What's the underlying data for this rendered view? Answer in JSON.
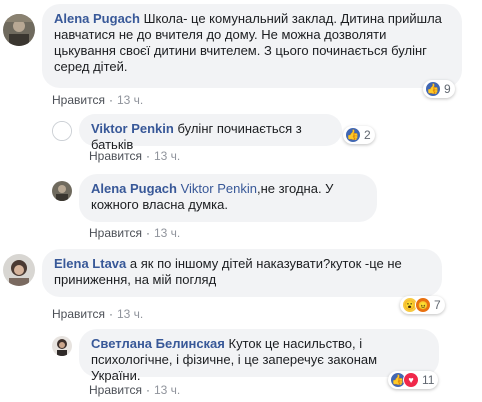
{
  "comments": [
    {
      "author": "Alena Pugach",
      "text": "Школа- це комунальний заклад. Дитина прийшла навчатися не до вчителя до дому. Не можна дозволяти цькування своєї дитини вчителем. З цього починається булінг серед дітей.",
      "like_label": "Нравится",
      "time": "13 ч.",
      "reaction_count": "9"
    },
    {
      "author": "Viktor Penkin",
      "text": "булінг починається з батьків",
      "like_label": "Нравится",
      "time": "13 ч.",
      "reaction_count": "2"
    },
    {
      "author": "Alena Pugach",
      "mention": "Viktor Penkin",
      "text": ",не згодна. У кожного власна думка.",
      "like_label": "Нравится",
      "time": "13 ч."
    },
    {
      "author": "Elena Ltava",
      "text": "а як по іншому дітей наказувати?куток -це не приниження, на мій погляд",
      "like_label": "Нравится",
      "time": "13 ч.",
      "reaction_count": "7"
    },
    {
      "author": "Светлана Белинская",
      "text": "Куток це насильство, і психологічне, і фізичне, і це заперечує законам України.",
      "like_label": "Нравится",
      "time": "13 ч.",
      "reaction_count": "11"
    }
  ],
  "colors": {
    "link": "#385898",
    "bubble": "#f2f3f5",
    "like": "#4167b2",
    "wow": "#f7c940",
    "angry": "#e9710f",
    "heart": "#f0284a"
  }
}
